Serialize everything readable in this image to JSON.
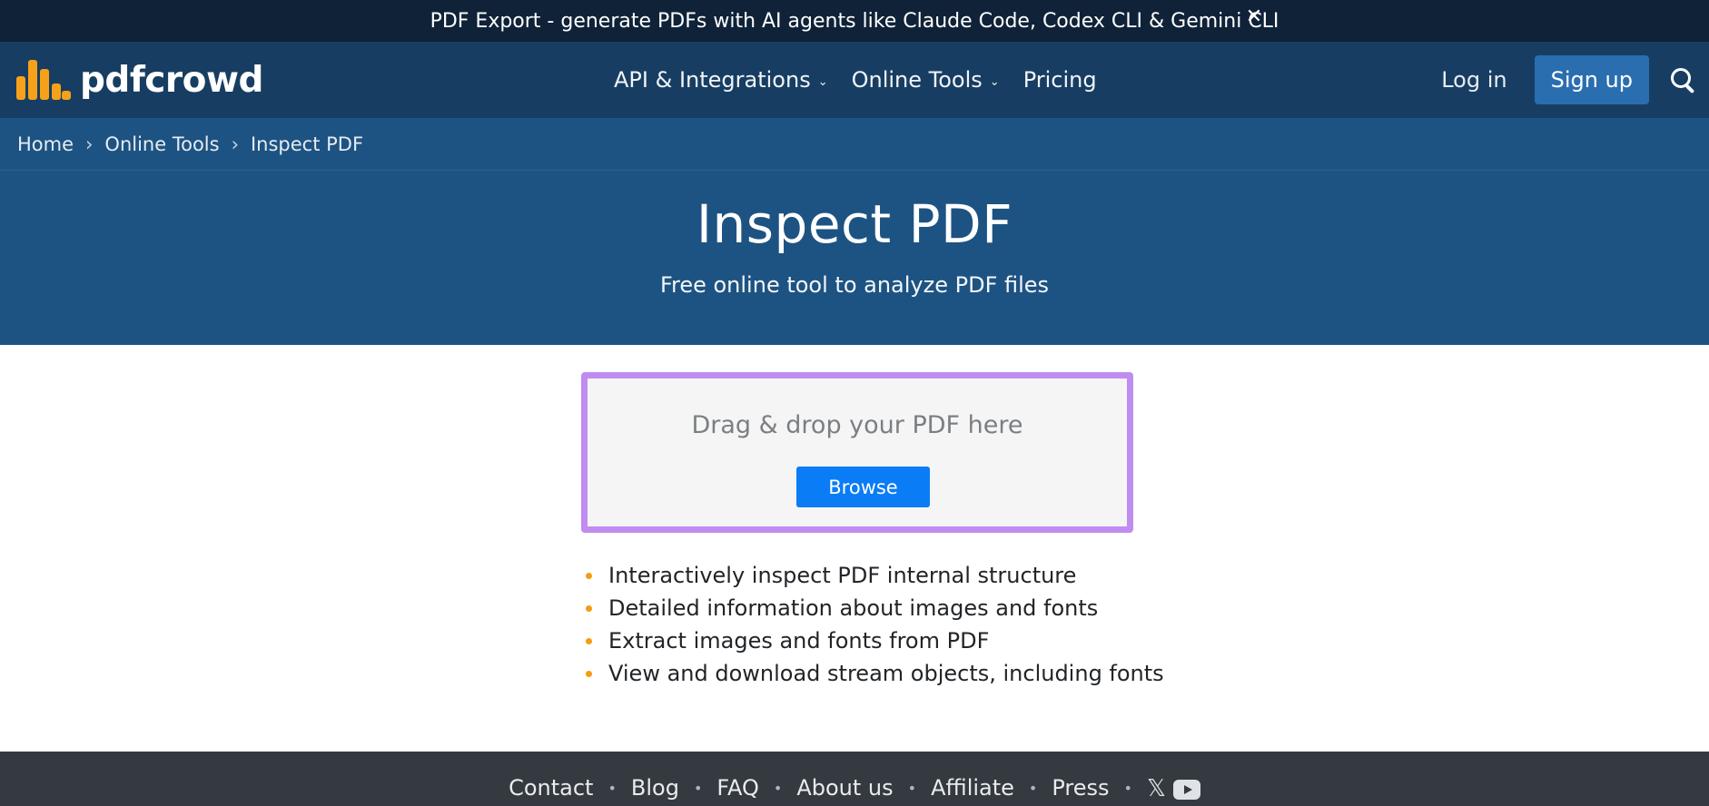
{
  "announcement": {
    "text": "PDF Export - generate PDFs with AI agents like Claude Code, Codex CLI & Gemini CLI",
    "close_glyph": "✕"
  },
  "navbar": {
    "logo_text": "pdfcrowd",
    "logo_icon": "bar-chart-logo-icon",
    "links": [
      {
        "label": "API & Integrations",
        "has_dropdown": true
      },
      {
        "label": "Online Tools",
        "has_dropdown": true
      },
      {
        "label": "Pricing",
        "has_dropdown": false
      }
    ],
    "caret_glyph": "⌄",
    "login_label": "Log in",
    "signup_label": "Sign up",
    "search_icon": "search-icon"
  },
  "breadcrumb": {
    "items": [
      "Home",
      "Online Tools",
      "Inspect PDF"
    ],
    "separator": "›"
  },
  "hero": {
    "title": "Inspect PDF",
    "subtitle": "Free online tool to analyze PDF files"
  },
  "dropzone": {
    "prompt": "Drag & drop your PDF here",
    "browse_label": "Browse"
  },
  "features": [
    "Interactively inspect PDF internal structure",
    "Detailed information about images and fonts",
    "Extract images and fonts from PDF",
    "View and download stream objects, including fonts"
  ],
  "footer": {
    "links": [
      "Contact",
      "Blog",
      "FAQ",
      "About us",
      "Affiliate",
      "Press"
    ],
    "separator": "•",
    "x_glyph": "𝕏",
    "social_icons": [
      "x-icon",
      "youtube-icon"
    ]
  },
  "colors": {
    "announcement_bg": "#0f2238",
    "navbar_bg": "#173e62",
    "hero_bg": "#1d5382",
    "signup_bg": "#2a6eb0",
    "logo_accent": "#f7a11a",
    "dropzone_border": "#c08cf0",
    "browse_bg": "#0a7cf5",
    "bullet": "#f39c12",
    "footer_bg": "#343a40"
  }
}
